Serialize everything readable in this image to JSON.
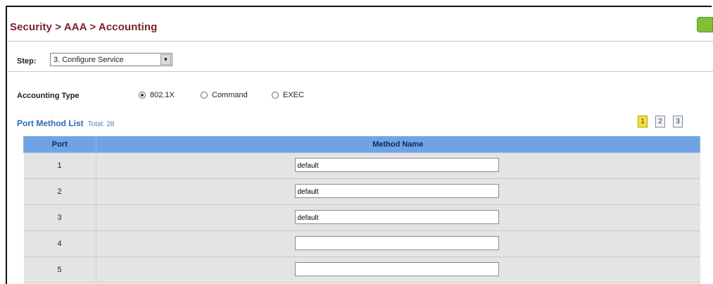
{
  "breadcrumb": "Security > AAA > Accounting",
  "step": {
    "label": "Step:",
    "value": "3. Configure Service"
  },
  "accounting_type": {
    "label": "Accounting Type",
    "options": [
      {
        "label": "802.1X",
        "checked": true
      },
      {
        "label": "Command",
        "checked": false
      },
      {
        "label": "EXEC",
        "checked": false
      }
    ]
  },
  "port_method_list": {
    "title": "Port Method List",
    "total": "Total: 28",
    "pages": [
      "1",
      "2",
      "3"
    ],
    "active_page": "1"
  },
  "table": {
    "headers": {
      "port": "Port",
      "method": "Method Name"
    },
    "rows": [
      {
        "port": "1",
        "method": "default"
      },
      {
        "port": "2",
        "method": "default"
      },
      {
        "port": "3",
        "method": "default"
      },
      {
        "port": "4",
        "method": ""
      },
      {
        "port": "5",
        "method": ""
      }
    ]
  },
  "colors": {
    "title": "#7a1f2b",
    "header_bg": "#6fa3e3",
    "row_bg": "#e4e4e4",
    "link": "#2f69b6"
  }
}
